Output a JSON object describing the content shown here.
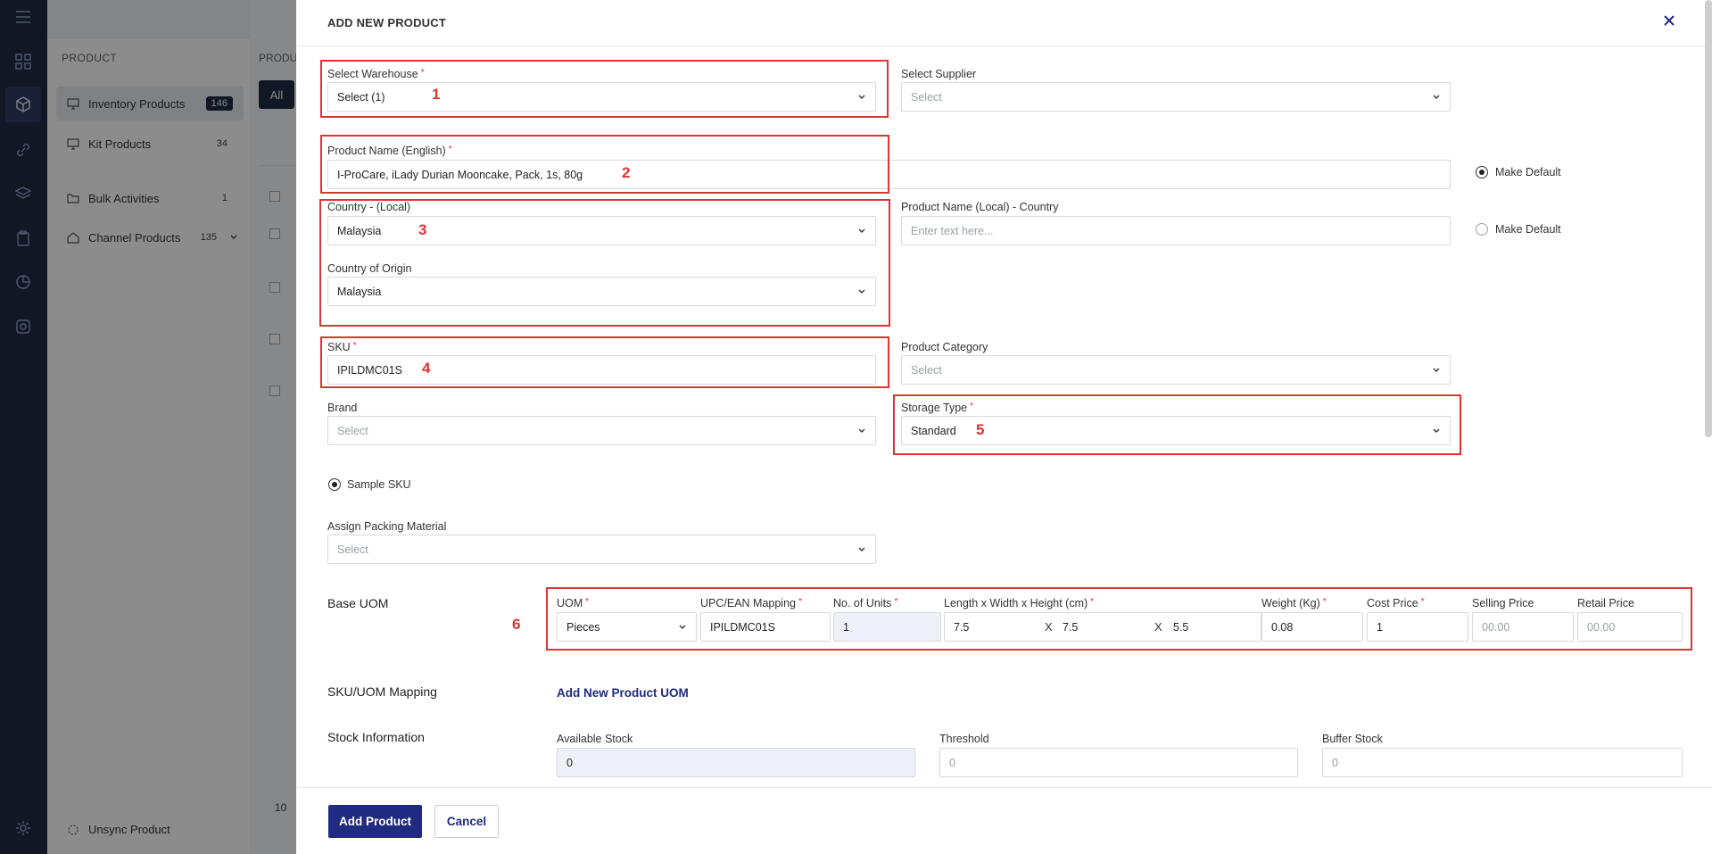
{
  "sidebar": {
    "section": "PRODUCT",
    "items": [
      {
        "label": "Inventory Products",
        "count": "146"
      },
      {
        "label": "Kit Products",
        "count": "34"
      },
      {
        "label": "Bulk Activities",
        "count": "1"
      },
      {
        "label": "Channel Products",
        "count": "135"
      }
    ],
    "unsync": "Unsync Product"
  },
  "background": {
    "page_heading": "PRODU",
    "tab_all": "All",
    "page_size": "10"
  },
  "modal": {
    "title": "ADD NEW PRODUCT",
    "warehouse": {
      "label": "Select Warehouse",
      "value": "Select (1)"
    },
    "supplier": {
      "label": "Select Supplier",
      "placeholder": "Select"
    },
    "product_name_en": {
      "label": "Product Name (English)",
      "value": "I-ProCare, iLady Durian Mooncake, Pack, 1s, 80g"
    },
    "make_default_1": "Make Default",
    "country_local": {
      "label": "Country - (Local)",
      "value": "Malaysia"
    },
    "product_name_local": {
      "label": "Product Name (Local) - Country",
      "placeholder": "Enter text here..."
    },
    "make_default_2": "Make Default",
    "country_origin": {
      "label": "Country of Origin",
      "value": "Malaysia"
    },
    "sku": {
      "label": "SKU",
      "value": "IPILDMC01S"
    },
    "category": {
      "label": "Product Category",
      "placeholder": "Select"
    },
    "brand": {
      "label": "Brand",
      "placeholder": "Select"
    },
    "storage_type": {
      "label": "Storage Type",
      "value": "Standard"
    },
    "sample_sku": "Sample SKU",
    "packing": {
      "label": "Assign Packing Material",
      "placeholder": "Select"
    },
    "base_uom": {
      "section": "Base UOM",
      "uom_label": "UOM",
      "uom_value": "Pieces",
      "upc_label": "UPC/EAN Mapping",
      "upc_value": "IPILDMC01S",
      "units_label": "No. of Units",
      "units_value": "1",
      "dims_label": "Length x Width x Height (cm)",
      "length": "7.5",
      "width": "7.5",
      "height": "5.5",
      "x": "X",
      "weight_label": "Weight (Kg)",
      "weight_value": "0.08",
      "cost_label": "Cost Price",
      "cost_value": "1",
      "selling_label": "Selling Price",
      "selling_placeholder": "00.00",
      "retail_label": "Retail Price",
      "retail_placeholder": "00.00"
    },
    "sku_uom": {
      "section": "SKU/UOM Mapping",
      "link": "Add New Product UOM"
    },
    "stock": {
      "section": "Stock Information",
      "available_label": "Available Stock",
      "available_value": "0",
      "threshold_label": "Threshold",
      "threshold_placeholder": "0",
      "buffer_label": "Buffer Stock",
      "buffer_placeholder": "0"
    },
    "annotations": [
      "1",
      "2",
      "3",
      "4",
      "5",
      "6"
    ],
    "buttons": {
      "add": "Add Product",
      "cancel": "Cancel"
    },
    "required_mark": "*"
  }
}
